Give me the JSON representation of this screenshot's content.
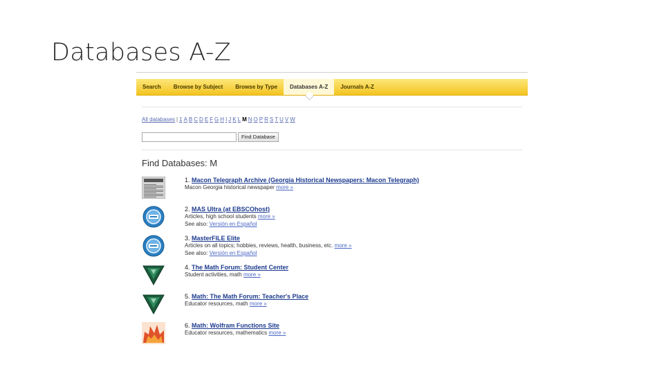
{
  "slide": {
    "title": "Databases A-Z"
  },
  "tabs": [
    {
      "label": "Search"
    },
    {
      "label": "Browse by Subject"
    },
    {
      "label": "Browse by Type"
    },
    {
      "label": "Databases A-Z",
      "active": true
    },
    {
      "label": "Journals A-Z"
    }
  ],
  "alpha": {
    "all_label": "All databases",
    "separator": "|",
    "letters": [
      "1",
      "A",
      "B",
      "C",
      "D",
      "E",
      "F",
      "G",
      "H",
      "I",
      "J",
      "K",
      "L",
      "M",
      "N",
      "O",
      "P",
      "R",
      "S",
      "T",
      "U",
      "V",
      "W"
    ],
    "selected": "M"
  },
  "search": {
    "value": "",
    "button_label": "Find Database"
  },
  "heading": "Find Databases:  M",
  "results": [
    {
      "number": "1.",
      "title": "Macon Telegraph Archive (Georgia Historical Newspapers: Macon Telegraph)",
      "description": "Macon Georgia historical newspaper",
      "more": "more »",
      "see_also_label": "",
      "see_also_link": "",
      "icon": "newspaper-icon"
    },
    {
      "number": "2.",
      "title": "MAS Ultra (at EBSCOhost)",
      "description": "Articles, high school students",
      "more": "more »",
      "see_also_label": "See also:",
      "see_also_link": "Versión en Español",
      "icon": "ebsco-icon"
    },
    {
      "number": "3.",
      "title": "MasterFILE Elite",
      "description": "Articles on all topics; hobbies, reviews, health, business, etc.",
      "more": "more »",
      "see_also_label": "See also:",
      "see_also_link": "Versión en Español",
      "icon": "ebsco-icon"
    },
    {
      "number": "4.",
      "title": "The Math Forum: Student Center",
      "description": "Student activities, math",
      "more": "more »",
      "see_also_label": "",
      "see_also_link": "",
      "icon": "math-forum-icon"
    },
    {
      "number": "5.",
      "title": "Math: The Math Forum: Teacher's Place",
      "description": "Educator resources, math",
      "more": "more »",
      "see_also_label": "",
      "see_also_link": "",
      "icon": "math-forum-icon"
    },
    {
      "number": "6.",
      "title": "Math: Wolfram Functions Site",
      "description": "Educator resources, mathematics",
      "more": "more »",
      "see_also_label": "",
      "see_also_link": "",
      "icon": "wolfram-icon"
    }
  ],
  "colors": {
    "tabbar": "#f3c420",
    "link": "#1d3b8f",
    "ebsco": "#2a7fc0",
    "math_forum": "#1a5a3a"
  }
}
